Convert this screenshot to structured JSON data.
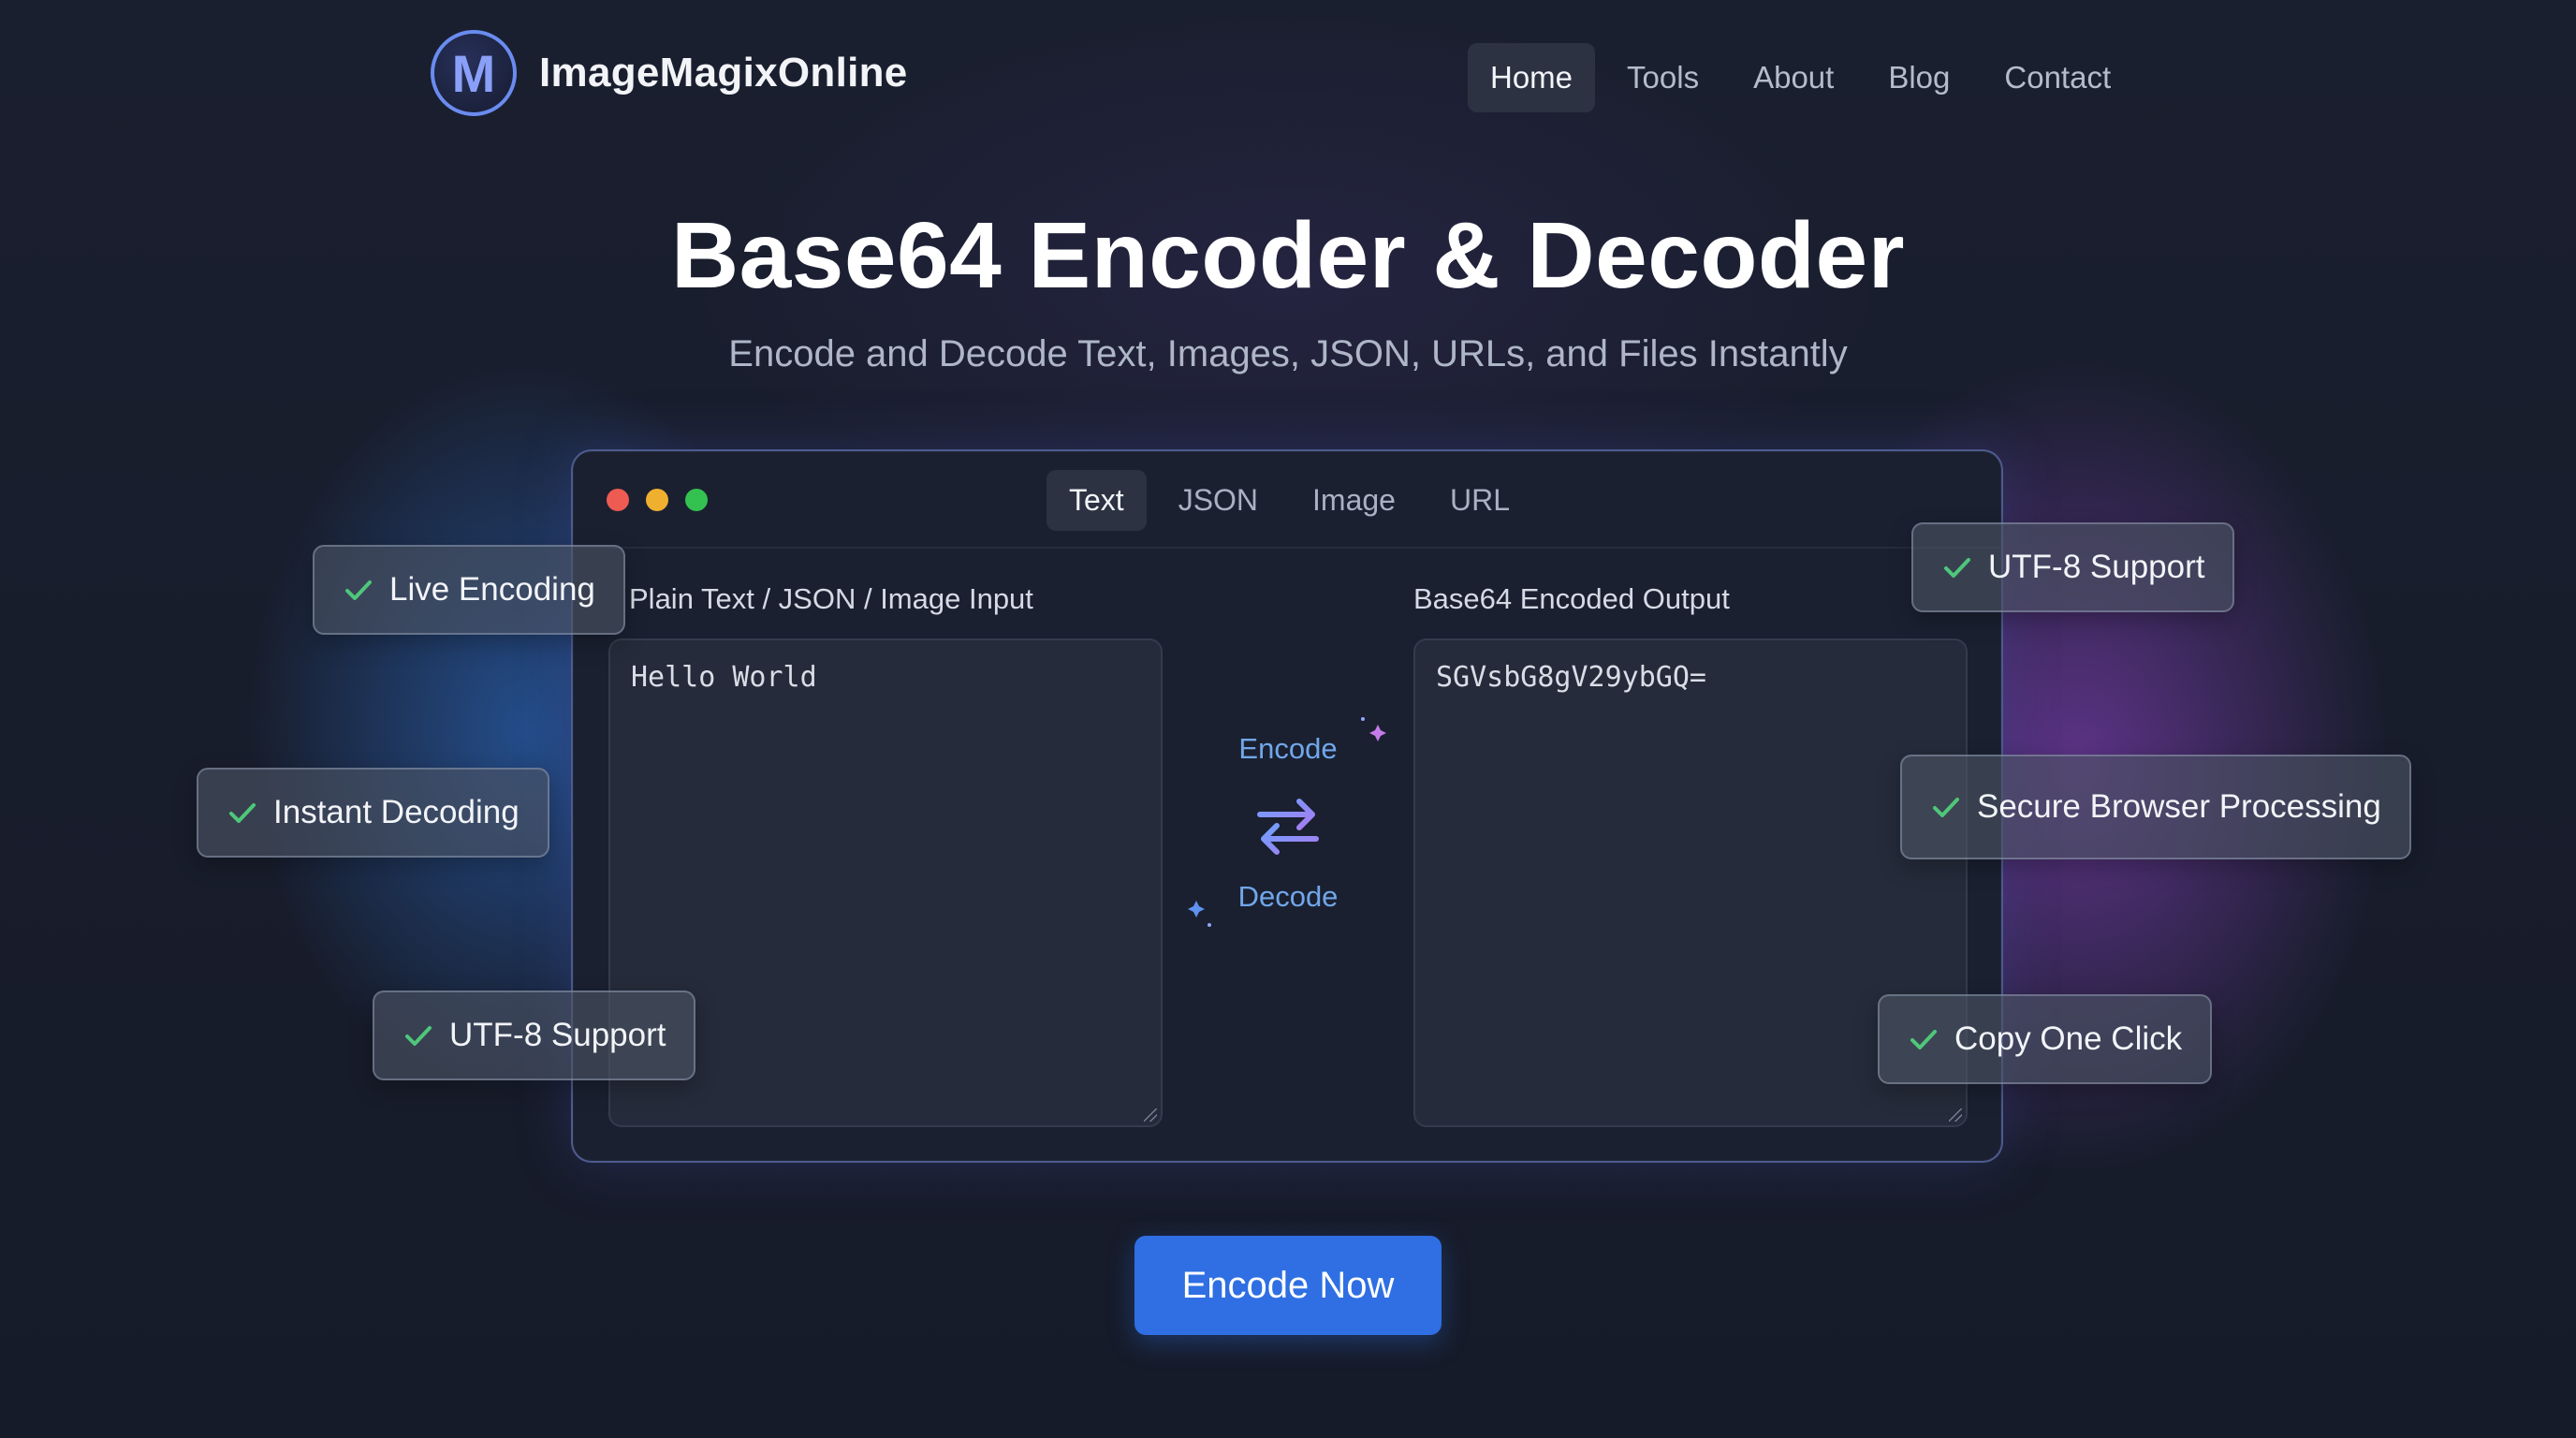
{
  "brand": {
    "logo_letter": "M",
    "name": "ImageMagixOnline"
  },
  "nav": {
    "items": [
      {
        "label": "Home",
        "active": true
      },
      {
        "label": "Tools",
        "active": false
      },
      {
        "label": "About",
        "active": false
      },
      {
        "label": "Blog",
        "active": false
      },
      {
        "label": "Contact",
        "active": false
      }
    ]
  },
  "hero": {
    "title": "Base64 Encoder & Decoder",
    "subtitle": "Encode and Decode Text, Images, JSON, URLs, and Files Instantly"
  },
  "tool": {
    "tabs": [
      {
        "label": "Text",
        "active": true
      },
      {
        "label": "JSON",
        "active": false
      },
      {
        "label": "Image",
        "active": false
      },
      {
        "label": "URL",
        "active": false
      }
    ],
    "input_label": "Plain Text / JSON / Image Input",
    "input_value": "Hello World",
    "output_label": "Base64 Encoded Output",
    "output_value": "SGVsbG8gV29ybGQ=",
    "encode_label": "Encode",
    "decode_label": "Decode",
    "icons": {
      "swap": "swap-arrows-icon",
      "window_controls": [
        "close-dot",
        "minimize-dot",
        "maximize-dot"
      ]
    }
  },
  "features": [
    "Live Encoding",
    "Instant Decoding",
    "UTF-8 Support",
    "UTF-8 Support",
    "Secure Browser Processing",
    "Copy One Click"
  ],
  "cta": {
    "label": "Encode Now"
  },
  "colors": {
    "background": "#181d2c",
    "accent_blue": "#2f6fe3",
    "check_green": "#4fc77a",
    "dot_red": "#ee5b52",
    "dot_yellow": "#f0b02f",
    "dot_green": "#33c24f",
    "encode_text": "#72a6ea"
  }
}
